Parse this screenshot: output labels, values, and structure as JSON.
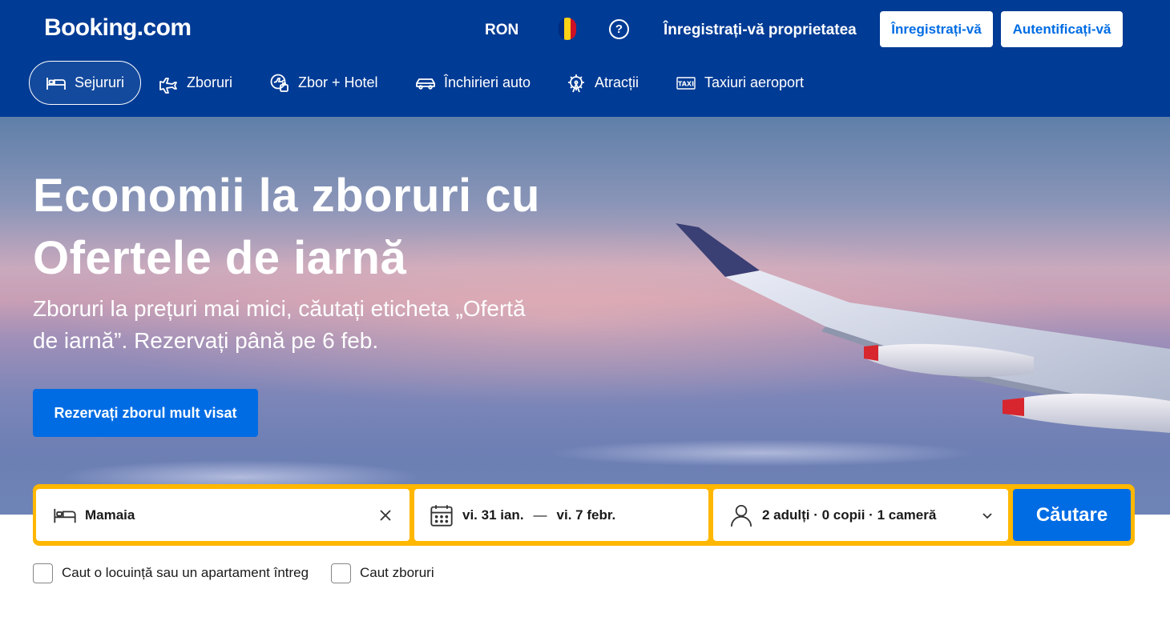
{
  "header": {
    "logo": "Booking.com",
    "currency": "RON",
    "flag_colors": [
      "#002b7f",
      "#fcd116",
      "#ce1126"
    ],
    "help_icon": "?",
    "list_property": "Înregistrați-vă proprietatea",
    "register_label": "Înregistrați-vă",
    "signin_label": "Autentificați-vă",
    "bg_color": "#003b95"
  },
  "nav": {
    "items": [
      {
        "label": "Sejururi",
        "icon": "bed-icon",
        "active": true
      },
      {
        "label": "Zboruri",
        "icon": "plane-icon",
        "active": false
      },
      {
        "label": "Zbor + Hotel",
        "icon": "flight-hotel-icon",
        "active": false
      },
      {
        "label": "Închirieri auto",
        "icon": "car-icon",
        "active": false
      },
      {
        "label": "Atracții",
        "icon": "attractions-icon",
        "active": false
      },
      {
        "label": "Taxiuri aeroport",
        "icon": "taxi-icon",
        "active": false
      }
    ]
  },
  "hero": {
    "title_line1": "Economii la zboruri cu",
    "title_line2": "Ofertele de iarnă",
    "subtitle_line1": "Zboruri la prețuri mai mici, căutați eticheta „Ofertă",
    "subtitle_line2": "de iarnă”. Rezervați până pe 6 feb.",
    "cta_label": "Rezervați zborul mult visat"
  },
  "search": {
    "destination_value": "Mamaia",
    "dates_start": "vi. 31 ian.",
    "dates_sep": "—",
    "dates_end": "vi. 7 febr.",
    "guests": "2 adulți · 0 copii · 1 cameră",
    "submit_label": "Căutare",
    "border_color": "#ffb700",
    "accent_color": "#006ce4"
  },
  "options": {
    "whole_place": "Caut o locuință sau un apartament întreg",
    "flights": "Caut zboruri"
  }
}
